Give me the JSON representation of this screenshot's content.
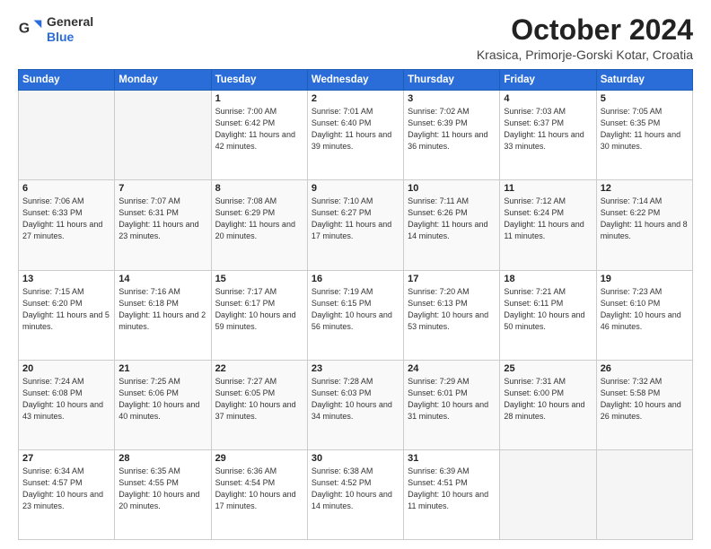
{
  "header": {
    "logo_line1": "General",
    "logo_line2": "Blue",
    "month": "October 2024",
    "location": "Krasica, Primorje-Gorski Kotar, Croatia"
  },
  "weekdays": [
    "Sunday",
    "Monday",
    "Tuesday",
    "Wednesday",
    "Thursday",
    "Friday",
    "Saturday"
  ],
  "weeks": [
    [
      {
        "day": "",
        "info": ""
      },
      {
        "day": "",
        "info": ""
      },
      {
        "day": "1",
        "info": "Sunrise: 7:00 AM\nSunset: 6:42 PM\nDaylight: 11 hours and 42 minutes."
      },
      {
        "day": "2",
        "info": "Sunrise: 7:01 AM\nSunset: 6:40 PM\nDaylight: 11 hours and 39 minutes."
      },
      {
        "day": "3",
        "info": "Sunrise: 7:02 AM\nSunset: 6:39 PM\nDaylight: 11 hours and 36 minutes."
      },
      {
        "day": "4",
        "info": "Sunrise: 7:03 AM\nSunset: 6:37 PM\nDaylight: 11 hours and 33 minutes."
      },
      {
        "day": "5",
        "info": "Sunrise: 7:05 AM\nSunset: 6:35 PM\nDaylight: 11 hours and 30 minutes."
      }
    ],
    [
      {
        "day": "6",
        "info": "Sunrise: 7:06 AM\nSunset: 6:33 PM\nDaylight: 11 hours and 27 minutes."
      },
      {
        "day": "7",
        "info": "Sunrise: 7:07 AM\nSunset: 6:31 PM\nDaylight: 11 hours and 23 minutes."
      },
      {
        "day": "8",
        "info": "Sunrise: 7:08 AM\nSunset: 6:29 PM\nDaylight: 11 hours and 20 minutes."
      },
      {
        "day": "9",
        "info": "Sunrise: 7:10 AM\nSunset: 6:27 PM\nDaylight: 11 hours and 17 minutes."
      },
      {
        "day": "10",
        "info": "Sunrise: 7:11 AM\nSunset: 6:26 PM\nDaylight: 11 hours and 14 minutes."
      },
      {
        "day": "11",
        "info": "Sunrise: 7:12 AM\nSunset: 6:24 PM\nDaylight: 11 hours and 11 minutes."
      },
      {
        "day": "12",
        "info": "Sunrise: 7:14 AM\nSunset: 6:22 PM\nDaylight: 11 hours and 8 minutes."
      }
    ],
    [
      {
        "day": "13",
        "info": "Sunrise: 7:15 AM\nSunset: 6:20 PM\nDaylight: 11 hours and 5 minutes."
      },
      {
        "day": "14",
        "info": "Sunrise: 7:16 AM\nSunset: 6:18 PM\nDaylight: 11 hours and 2 minutes."
      },
      {
        "day": "15",
        "info": "Sunrise: 7:17 AM\nSunset: 6:17 PM\nDaylight: 10 hours and 59 minutes."
      },
      {
        "day": "16",
        "info": "Sunrise: 7:19 AM\nSunset: 6:15 PM\nDaylight: 10 hours and 56 minutes."
      },
      {
        "day": "17",
        "info": "Sunrise: 7:20 AM\nSunset: 6:13 PM\nDaylight: 10 hours and 53 minutes."
      },
      {
        "day": "18",
        "info": "Sunrise: 7:21 AM\nSunset: 6:11 PM\nDaylight: 10 hours and 50 minutes."
      },
      {
        "day": "19",
        "info": "Sunrise: 7:23 AM\nSunset: 6:10 PM\nDaylight: 10 hours and 46 minutes."
      }
    ],
    [
      {
        "day": "20",
        "info": "Sunrise: 7:24 AM\nSunset: 6:08 PM\nDaylight: 10 hours and 43 minutes."
      },
      {
        "day": "21",
        "info": "Sunrise: 7:25 AM\nSunset: 6:06 PM\nDaylight: 10 hours and 40 minutes."
      },
      {
        "day": "22",
        "info": "Sunrise: 7:27 AM\nSunset: 6:05 PM\nDaylight: 10 hours and 37 minutes."
      },
      {
        "day": "23",
        "info": "Sunrise: 7:28 AM\nSunset: 6:03 PM\nDaylight: 10 hours and 34 minutes."
      },
      {
        "day": "24",
        "info": "Sunrise: 7:29 AM\nSunset: 6:01 PM\nDaylight: 10 hours and 31 minutes."
      },
      {
        "day": "25",
        "info": "Sunrise: 7:31 AM\nSunset: 6:00 PM\nDaylight: 10 hours and 28 minutes."
      },
      {
        "day": "26",
        "info": "Sunrise: 7:32 AM\nSunset: 5:58 PM\nDaylight: 10 hours and 26 minutes."
      }
    ],
    [
      {
        "day": "27",
        "info": "Sunrise: 6:34 AM\nSunset: 4:57 PM\nDaylight: 10 hours and 23 minutes."
      },
      {
        "day": "28",
        "info": "Sunrise: 6:35 AM\nSunset: 4:55 PM\nDaylight: 10 hours and 20 minutes."
      },
      {
        "day": "29",
        "info": "Sunrise: 6:36 AM\nSunset: 4:54 PM\nDaylight: 10 hours and 17 minutes."
      },
      {
        "day": "30",
        "info": "Sunrise: 6:38 AM\nSunset: 4:52 PM\nDaylight: 10 hours and 14 minutes."
      },
      {
        "day": "31",
        "info": "Sunrise: 6:39 AM\nSunset: 4:51 PM\nDaylight: 10 hours and 11 minutes."
      },
      {
        "day": "",
        "info": ""
      },
      {
        "day": "",
        "info": ""
      }
    ]
  ]
}
